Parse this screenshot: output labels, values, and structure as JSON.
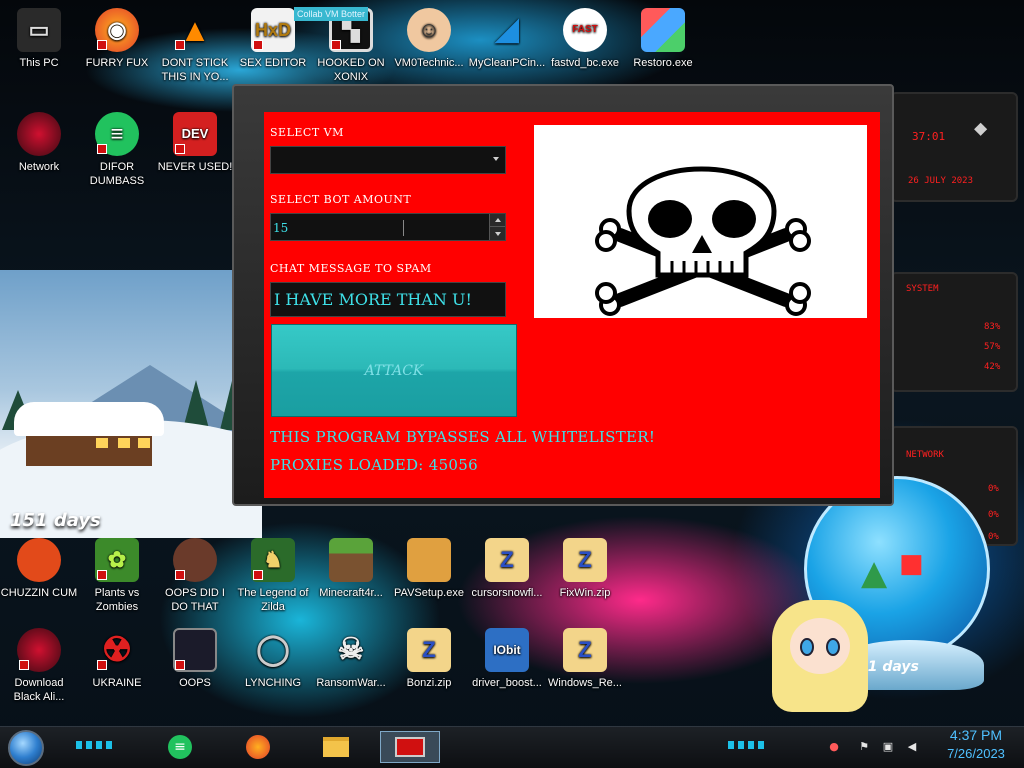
{
  "window": {
    "title": "Collab VM Botter",
    "select_vm_label": "SELECT VM",
    "select_vm_value": "",
    "bot_amount_label": "SELECT BOT AMOUNT",
    "bot_amount_value": "15",
    "chat_label": "CHAT MESSAGE TO SPAM",
    "chat_value": "I HAVE MORE THAN U!",
    "attack_label": "ATTACK",
    "note_bypass": "THIS PROGRAM BYPASSES ALL WHITELISTER!",
    "note_proxies": "PROXIES LOADED: 45056",
    "image_icon": "skull-and-crossbones-icon"
  },
  "desktop_icons": [
    {
      "label": "This PC",
      "icon": "computer-icon"
    },
    {
      "label": "FURRY FUX",
      "icon": "firefox-icon"
    },
    {
      "label": "DONT STICK THIS IN YO...",
      "icon": "vlc-cone-icon"
    },
    {
      "label": "SEX EDITOR",
      "icon": "hxd-editor-icon"
    },
    {
      "label": "HOOKED ON XONIX",
      "icon": "xonix-game-icon"
    },
    {
      "label": "VM0Technic...",
      "icon": "doctor-icon"
    },
    {
      "label": "MyCleanPCin...",
      "icon": "mycleanpc-icon"
    },
    {
      "label": "fastvd_bc.exe",
      "icon": "fast-video-downloader-icon"
    },
    {
      "label": "Restoro.exe",
      "icon": "restoro-icon"
    },
    {
      "label": "Network",
      "icon": "network-icon"
    },
    {
      "label": "DIFOR DUMBASS",
      "icon": "chat-bubble-icon"
    },
    {
      "label": "NEVER USED!",
      "icon": "dev-cpp-icon"
    },
    {
      "label": "CHUZZIN CUM",
      "icon": "chuzzle-icon"
    },
    {
      "label": "Plants vs Zombies",
      "icon": "plants-vs-zombies-icon"
    },
    {
      "label": "OOPS DID I DO THAT",
      "icon": "portrait-icon"
    },
    {
      "label": "The Legend of Zilda",
      "icon": "zelda-sprite-icon"
    },
    {
      "label": "Minecraft4r...",
      "icon": "minecraft-block-icon"
    },
    {
      "label": "PAVSetup.exe",
      "icon": "installer-box-icon"
    },
    {
      "label": "cursorsnowfl...",
      "icon": "zip-folder-icon"
    },
    {
      "label": "FixWin.zip",
      "icon": "zip-folder-icon"
    },
    {
      "label": "Download Black Ali...",
      "icon": "alienware-icon"
    },
    {
      "label": "UKRAINE",
      "icon": "radiation-icon"
    },
    {
      "label": "OOPS",
      "icon": "window-app-icon"
    },
    {
      "label": "LYNCHING",
      "icon": "noose-icon"
    },
    {
      "label": "RansomWar...",
      "icon": "skull-icon"
    },
    {
      "label": "Bonzi.zip",
      "icon": "zip-folder-icon"
    },
    {
      "label": "driver_boost...",
      "icon": "iobit-driver-booster-icon"
    },
    {
      "label": "Windows_Re...",
      "icon": "zip-folder-icon"
    }
  ],
  "hud": {
    "date_text": "26 JULY 2023",
    "time_text": "37:01",
    "system_label": "SYSTEM",
    "network_label": "NETWORK",
    "cpu_pct": "83%",
    "ram_pct": "57%",
    "disk_pct": "42%",
    "net_a": "0%",
    "net_b": "0%",
    "net_c": "0%"
  },
  "widget": {
    "snow_days": "151 days",
    "globe_days": "51 days"
  },
  "taskbar": {
    "items": [
      {
        "icon": "chat-app-icon"
      },
      {
        "icon": "firefox-icon"
      },
      {
        "icon": "file-explorer-icon"
      },
      {
        "icon": "collab-vm-botter-app-icon"
      }
    ],
    "tray": [
      "chat-badge-icon",
      "flag-icon",
      "network-tray-icon",
      "volume-icon"
    ],
    "time": "4:37 PM",
    "date": "7/26/2023"
  },
  "colors": {
    "client_bg": "#ff0000",
    "accent_cyan": "#3ee0e8",
    "button_teal": "#2cb9b7",
    "clock_blue": "#4fc0ff"
  }
}
